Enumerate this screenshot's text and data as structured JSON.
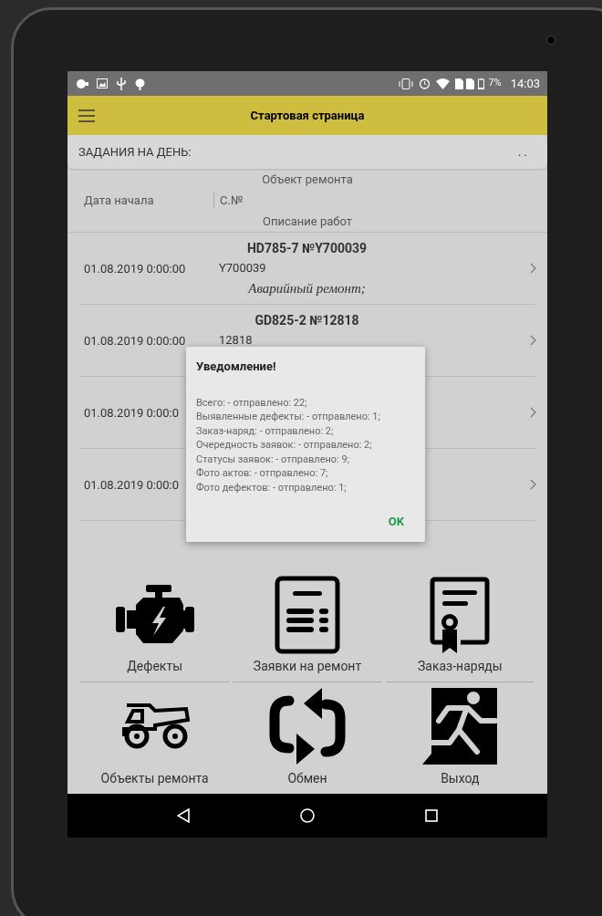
{
  "status_bar": {
    "battery": "7%",
    "time": "14:03"
  },
  "app_bar": {
    "title": "Стартовая страница"
  },
  "tasks_header": {
    "label": "ЗАДАНИЯ НА ДЕНЬ:",
    "more": ". ."
  },
  "columns": {
    "top": "Объект ремонта",
    "left": "Дата начала",
    "middle": "С.№",
    "bottom": "Описание работ"
  },
  "rows": [
    {
      "object": "HD785-7 №Y700039",
      "date": "01.08.2019 0:00:00",
      "serial": "Y700039",
      "description": "Аварийный ремонт;"
    },
    {
      "object": "GD825-2 №12818",
      "date": "01.08.2019 0:00:00",
      "serial": "12818"
    },
    {
      "date": "01.08.2019 0:00:0"
    },
    {
      "date": "01.08.2019 0:00:0"
    }
  ],
  "dialog": {
    "title": "Уведомление!",
    "lines": [
      "Всего: - отправлено: 22;",
      "Выявленные дефекты: - отправлено: 1;",
      "Заказ-наряд: - отправлено: 2;",
      "Очередность заявок: - отправлено: 2;",
      "Статусы заявок: - отправлено: 9;",
      "Фото актов: - отправлено: 7;",
      "Фото дефектов: - отправлено: 1;"
    ],
    "button": "OK"
  },
  "tiles": [
    {
      "kind": "engine",
      "label": "Дефекты"
    },
    {
      "kind": "document",
      "label": "Заявки на ремонт"
    },
    {
      "kind": "certificate",
      "label": "Заказ-наряды"
    },
    {
      "kind": "truck",
      "label": "Объекты ремонта"
    },
    {
      "kind": "sync",
      "label": "Обмен"
    },
    {
      "kind": "exit",
      "label": "Выход"
    }
  ]
}
